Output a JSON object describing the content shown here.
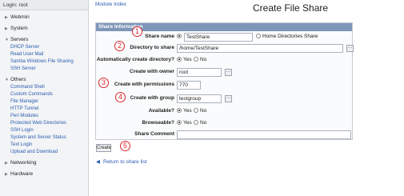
{
  "sidebar": {
    "login": "Login: root",
    "sections": {
      "webmin": "Webmin",
      "system": "System",
      "servers": "Servers",
      "others": "Others",
      "networking": "Networking",
      "hardware": "Hardware"
    },
    "servers_links": [
      "DHCP Server",
      "Read User Mail",
      "Samba Windows File Sharing",
      "SSH Server"
    ],
    "others_links": [
      "Command Shell",
      "Custom Commands",
      "File Manager",
      "HTTP Tunnel",
      "Perl Modules",
      "Protected Web Directories",
      "SSH Login",
      "System and Server Status",
      "Text Login",
      "Upload and Download"
    ]
  },
  "header": {
    "module_index": "Module Index",
    "title": "Create File Share"
  },
  "form": {
    "section_title": "Share Information",
    "share_name": {
      "label": "Share name",
      "value": "TestShare",
      "alt_option": "Home Directories Share"
    },
    "directory": {
      "label": "Directory to share",
      "value": "/home/TestShare"
    },
    "auto_create": {
      "label": "Automatically create directory?",
      "yes": "Yes",
      "no": "No"
    },
    "owner": {
      "label": "Create with owner",
      "value": "root"
    },
    "permissions": {
      "label": "Create with permissions",
      "value": "770"
    },
    "group": {
      "label": "Create with group",
      "value": "testgroup"
    },
    "available": {
      "label": "Available?",
      "yes": "Yes",
      "no": "No"
    },
    "browseable": {
      "label": "Browseable?",
      "yes": "Yes",
      "no": "No"
    },
    "comment": {
      "label": "Share Comment",
      "value": ""
    }
  },
  "actions": {
    "create": "Create",
    "return_link": "Return to share list"
  },
  "markers": [
    "1",
    "2",
    "3",
    "4",
    "5"
  ],
  "colors": {
    "marker": "#d8262c",
    "link": "#2a5db0",
    "panel_header": "#7f96b8"
  }
}
